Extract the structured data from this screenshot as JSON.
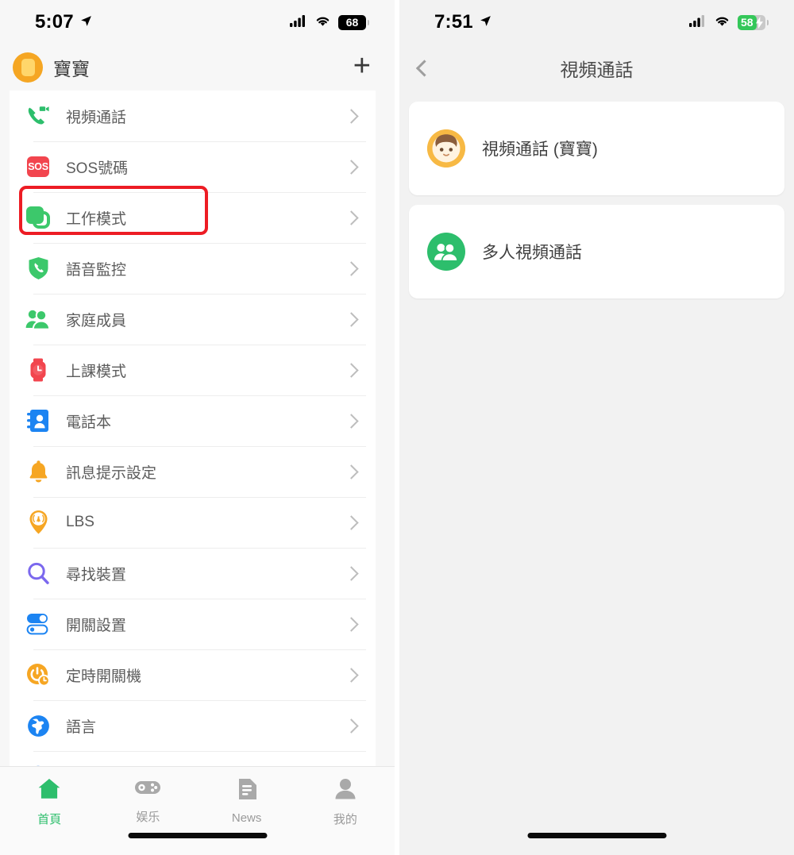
{
  "left_phone": {
    "status_bar": {
      "time": "5:07",
      "location_icon": "location-arrow-icon",
      "cellular_icon": "cellular-signal-icon",
      "wifi_icon": "wifi-icon",
      "battery_level": "68",
      "battery_charging": false,
      "battery_color": "#000000"
    },
    "app_bar": {
      "avatar_icon": "watch-avatar-icon",
      "title": "寶寶",
      "add_label": "+"
    },
    "highlight": {
      "color": "#ED1C24",
      "target": "視頻通話"
    },
    "menu": [
      {
        "icon": "video-call-icon",
        "label": "視頻通話",
        "color": "#2DBE6C",
        "highlighted": true
      },
      {
        "icon": "sos-icon",
        "label": "SOS號碼",
        "color": "#F2454E",
        "highlighted": false
      },
      {
        "icon": "work-mode-icon",
        "label": "工作模式",
        "color": "#3CC86B",
        "highlighted": false
      },
      {
        "icon": "voice-monitor-icon",
        "label": "語音監控",
        "color": "#3CC86B",
        "highlighted": false
      },
      {
        "icon": "family-members-icon",
        "label": "家庭成員",
        "color": "#3CC86B",
        "highlighted": false
      },
      {
        "icon": "class-mode-watch-icon",
        "label": "上課模式",
        "color": "#F2454E",
        "highlighted": false
      },
      {
        "icon": "phonebook-icon",
        "label": "電話本",
        "color": "#1C84F2",
        "highlighted": false
      },
      {
        "icon": "notification-bell-icon",
        "label": "訊息提示設定",
        "color": "#F6A623",
        "highlighted": false
      },
      {
        "icon": "lbs-location-icon",
        "label": "LBS",
        "color": "#F6A623",
        "highlighted": false
      },
      {
        "icon": "find-device-icon",
        "label": "尋找裝置",
        "color": "#7B68EE",
        "highlighted": false
      },
      {
        "icon": "switch-settings-icon",
        "label": "開關設置",
        "color": "#1C84F2",
        "highlighted": false
      },
      {
        "icon": "power-timer-icon",
        "label": "定時開關機",
        "color": "#F6A623",
        "highlighted": false
      },
      {
        "icon": "language-globe-icon",
        "label": "語言",
        "color": "#1C84F2",
        "highlighted": false
      }
    ],
    "tab_bar": [
      {
        "icon": "home-icon",
        "label": "首頁",
        "active": true
      },
      {
        "icon": "gamepad-icon",
        "label": "娱乐",
        "active": false
      },
      {
        "icon": "news-icon",
        "label": "News",
        "active": false
      },
      {
        "icon": "person-icon",
        "label": "我的",
        "active": false
      }
    ]
  },
  "right_phone": {
    "status_bar": {
      "time": "7:51",
      "location_icon": "location-arrow-icon",
      "cellular_icon": "cellular-signal-icon",
      "wifi_icon": "wifi-icon",
      "battery_level": "58",
      "battery_charging": true,
      "battery_color": "#34C759"
    },
    "nav_bar": {
      "back_icon": "chevron-left-icon",
      "title": "視頻通話"
    },
    "cards": [
      {
        "icon": "kid-avatar-icon",
        "label": "視頻通話 (寶寶)",
        "color": "#F7B944"
      },
      {
        "icon": "group-people-icon",
        "label": "多人視頻通話",
        "color": "#2DBE6C"
      }
    ]
  }
}
